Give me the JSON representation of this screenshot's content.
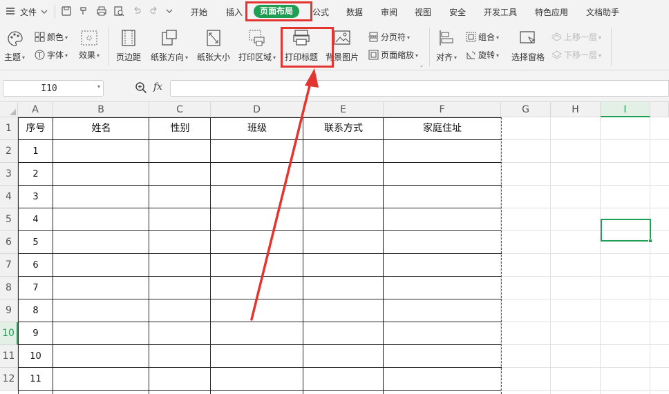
{
  "menubar": {
    "hamburger_label": "文件",
    "tabs": [
      "开始",
      "插入",
      "页面布局",
      "公式",
      "数据",
      "审阅",
      "视图",
      "安全",
      "开发工具",
      "特色应用",
      "文档助手"
    ],
    "active_tab": "页面布局",
    "accent_color": "#1f9f54"
  },
  "ribbon": {
    "theme_label": "主题",
    "color_label": "颜色",
    "font_label": "字体",
    "effect_label": "效果",
    "margins_label": "页边距",
    "orientation_label": "纸张方向",
    "size_label": "纸张大小",
    "print_area_label": "打印区域",
    "print_titles_label": "打印标题",
    "background_label": "背景图片",
    "page_break_label": "分页符",
    "page_scale_label": "页面缩放",
    "align_label": "对齐",
    "group_label": "组合",
    "rotate_label": "旋转",
    "selection_pane_label": "选择窗格",
    "bring_forward_label": "上移一层",
    "send_backward_label": "下移一层"
  },
  "formula_bar": {
    "name_box_value": "I10",
    "fx_label": "fx",
    "formula_value": ""
  },
  "sheet": {
    "columns": [
      "A",
      "B",
      "C",
      "D",
      "E",
      "F",
      "G",
      "H",
      "I"
    ],
    "selected_column": "I",
    "rows": [
      "1",
      "2",
      "3",
      "4",
      "5",
      "6",
      "7",
      "8",
      "9",
      "10",
      "11",
      "12"
    ],
    "selected_row": "10",
    "header_cells": [
      "序号",
      "姓名",
      "性别",
      "班级",
      "联系方式",
      "家庭住址"
    ],
    "serial_numbers": [
      "1",
      "2",
      "3",
      "4",
      "5",
      "6",
      "7",
      "8",
      "9",
      "10",
      "11"
    ],
    "selected_cell": "I10"
  },
  "annotations": {
    "highlight_color": "#e3342f"
  }
}
